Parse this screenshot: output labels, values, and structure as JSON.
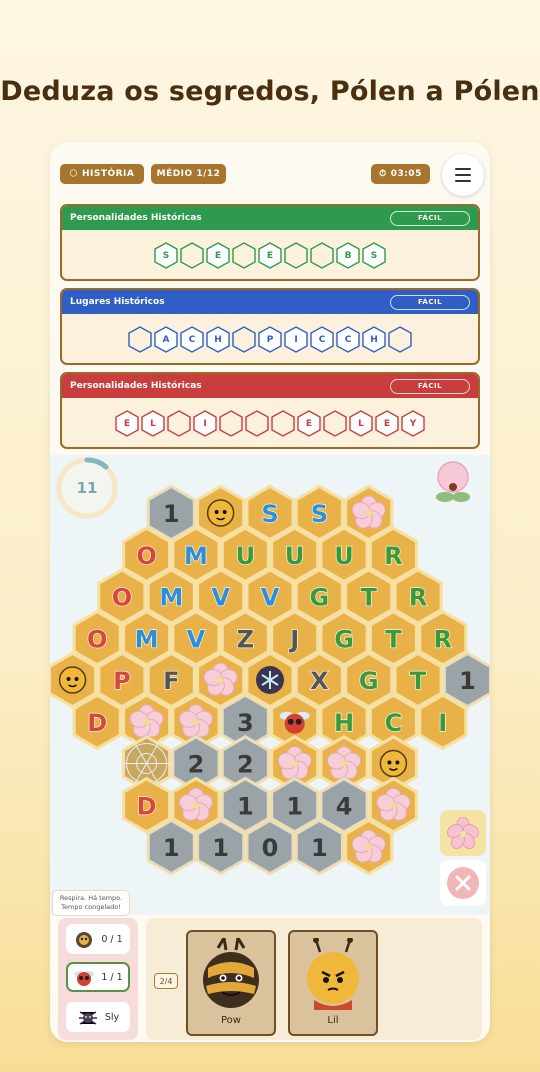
{
  "headline": "Deduza os segredos, Pólen a Pólen",
  "topbar": {
    "category": "HISTÓRIA",
    "level": "MÉDIO 1/12",
    "time": "03:05"
  },
  "puzzles": [
    {
      "title": "Personalidades Históricas",
      "difficulty": "FÁCIL",
      "color": "#2e9a4e",
      "cells": [
        "S",
        "",
        "E",
        "",
        "E",
        "",
        "",
        "B",
        "S"
      ]
    },
    {
      "title": "Lugares Históricos",
      "difficulty": "FÁCIL",
      "color": "#2f5fc4",
      "cells": [
        "",
        "A",
        "C",
        "H",
        "",
        "P",
        "I",
        "C",
        "C",
        "H",
        ""
      ]
    },
    {
      "title": "Personalidades Históricas",
      "difficulty": "FÁCIL",
      "color": "#c93d3d",
      "cells": [
        "E",
        "L",
        "",
        "I",
        "",
        "",
        "",
        "E",
        "",
        "L",
        "E",
        "Y"
      ]
    }
  ],
  "board": {
    "timer": "11",
    "rows": [
      [
        "1",
        "bee",
        "S",
        "S",
        "flower"
      ],
      [
        "O",
        "M",
        "U",
        "U",
        "U",
        "R"
      ],
      [
        "O",
        "M",
        "V",
        "V",
        "G",
        "T",
        "R"
      ],
      [
        "O",
        "M",
        "V",
        "Z",
        "J",
        "G",
        "T",
        "R"
      ],
      [
        "bee",
        "P",
        "F",
        "flower",
        "ice",
        "X",
        "G",
        "T",
        "1"
      ],
      [
        "D",
        "flower",
        "flower",
        "3",
        "fly",
        "H",
        "C",
        "I"
      ],
      [
        "web",
        "2",
        "2",
        "flower",
        "flower",
        "bee"
      ],
      [
        "D",
        "flower",
        "1",
        "1",
        "4",
        "flower"
      ],
      [
        "1",
        "1",
        "0",
        "1",
        "flower"
      ]
    ]
  },
  "hint_note": "Respira. Há tempo. Tempo congelado!",
  "characters": [
    {
      "label": "0 / 1",
      "icon": "bee-icon"
    },
    {
      "label": "1 / 1",
      "icon": "fly-icon"
    },
    {
      "label": "Sly",
      "icon": "spider-icon"
    }
  ],
  "tray": {
    "count": "2/4",
    "cards": [
      {
        "name": "Pow"
      },
      {
        "name": "Lil"
      }
    ]
  },
  "colors": {
    "green": "#3a9a3a",
    "blue": "#2f8fd6",
    "red": "#d9463a",
    "gold": "#e8b248",
    "grey": "#9aa3a8"
  }
}
